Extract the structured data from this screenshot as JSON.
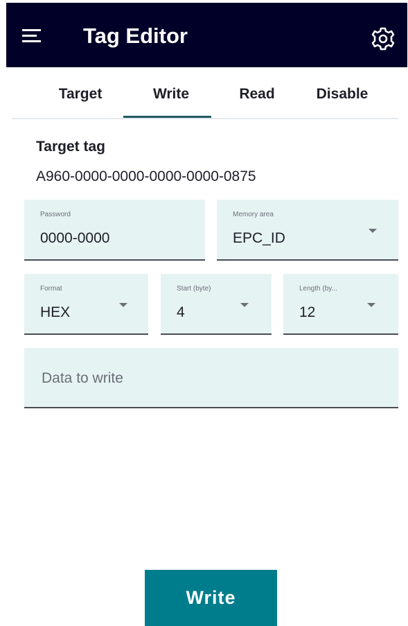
{
  "app": {
    "title": "Tag Editor",
    "menu_icon": "hamburger-menu-icon",
    "settings_icon": "gear-icon"
  },
  "tabs": [
    {
      "label": "Target"
    },
    {
      "label": "Write"
    },
    {
      "label": "Read"
    },
    {
      "label": "Disable"
    }
  ],
  "active_tab": "Write",
  "target": {
    "heading": "Target tag",
    "tag_id": "A960-0000-0000-0000-0000-0875"
  },
  "fields": {
    "password": {
      "label": "Password",
      "value": "0000-0000"
    },
    "memory_area": {
      "label": "Memory area",
      "value": "EPC_ID"
    },
    "format": {
      "label": "Format",
      "value": "HEX"
    },
    "start": {
      "label": "Start (byte)",
      "value": "4"
    },
    "length": {
      "label": "Length (by...",
      "value": "12"
    },
    "data": {
      "placeholder": "Data to write",
      "value": ""
    }
  },
  "write_button": {
    "label": "Write"
  },
  "colors": {
    "header_bg": "#000028",
    "field_bg": "#e6f3f3",
    "accent": "#007d8c",
    "tab_indicator": "#1e5a64"
  }
}
